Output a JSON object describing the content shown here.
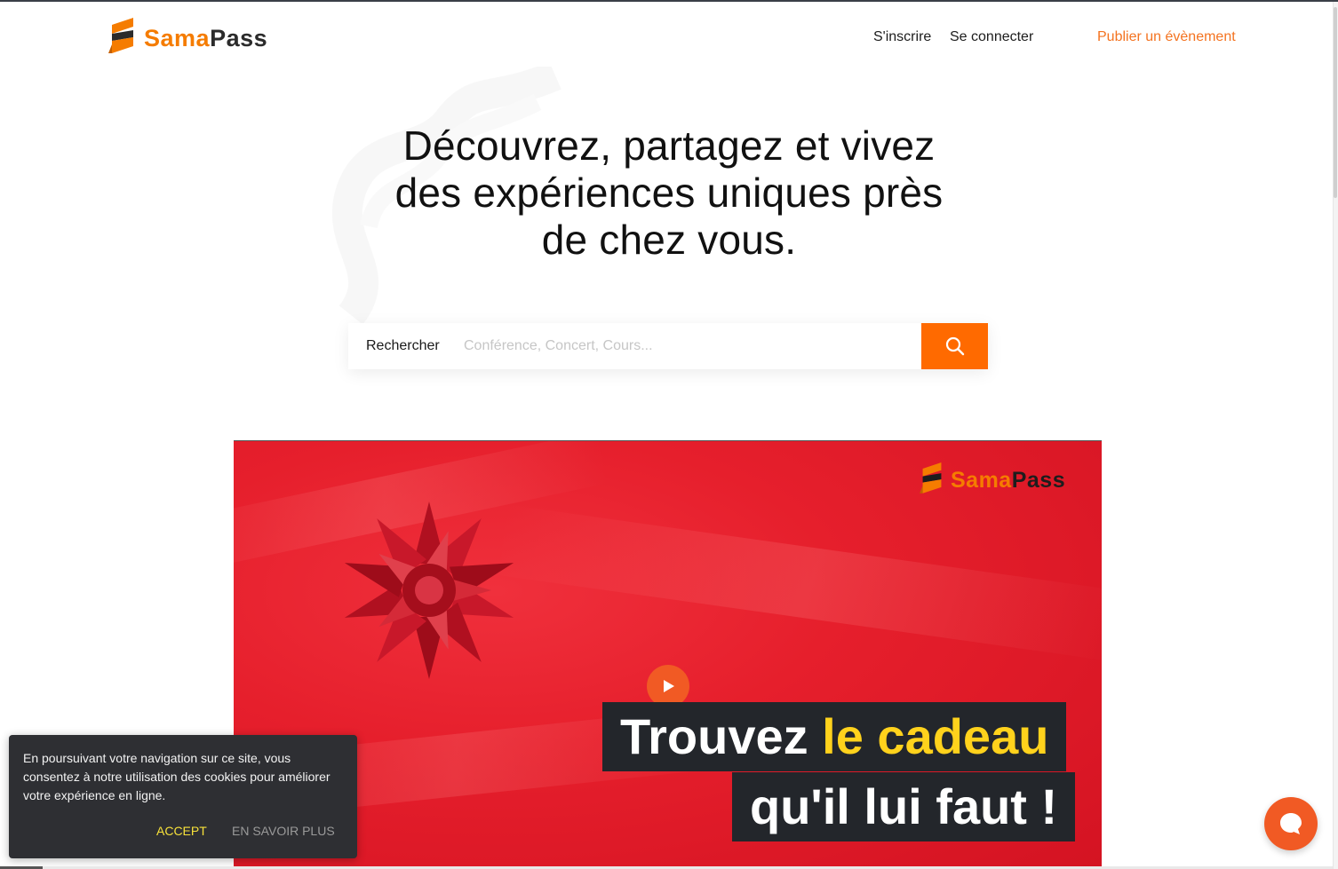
{
  "header": {
    "logo": {
      "part1": "Sama",
      "part2": "Pass"
    },
    "nav": {
      "signup": "S'inscrire",
      "login": "Se connecter",
      "publish": "Publier un évènement"
    }
  },
  "hero": {
    "title_line1": "Découvrez, partagez et vivez",
    "title_line2": "des expériences uniques près",
    "title_line3": "de chez vous."
  },
  "search": {
    "label": "Rechercher",
    "placeholder": "Conférence, Concert, Cours...",
    "button_icon": "search-icon"
  },
  "banner": {
    "logo": {
      "part1": "Sama",
      "part2": "Pass"
    },
    "caption_part1": "Trouvez ",
    "caption_highlight": "le cadeau",
    "caption_line2": "qu'il lui faut !",
    "play_icon": "play-icon"
  },
  "cookie": {
    "text": "En poursuivant votre navigation sur ce site, vous consentez à notre utilisation des cookies pour améliorer votre expérience en ligne.",
    "accept": "ACCEPT",
    "learn_more": "EN SAVOIR PLUS"
  },
  "chat": {
    "icon": "chat-bubble-icon"
  },
  "colors": {
    "brand_orange": "#f47320",
    "search_button": "#ff6a00",
    "banner_red": "#e61f2c",
    "caption_highlight": "#ffd21c",
    "cookie_accept": "#f7e13a"
  }
}
